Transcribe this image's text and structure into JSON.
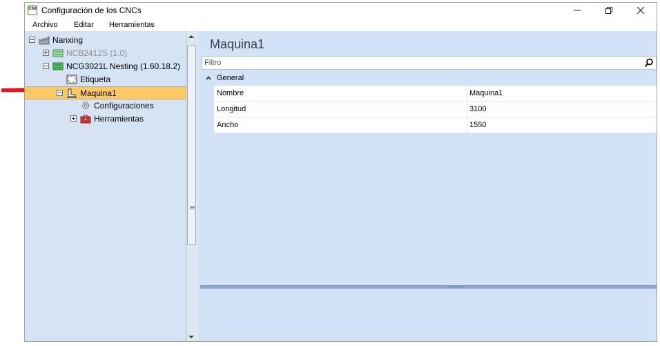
{
  "window": {
    "title": "Configuración de los CNCs",
    "icon_text": "CNC",
    "controls": {
      "minimize": "minimize-icon",
      "maximize": "restore-icon",
      "close": "close-icon"
    }
  },
  "menu": {
    "items": [
      "Archivo",
      "Editar",
      "Herramientas"
    ]
  },
  "tree": {
    "nodes": [
      {
        "label": "Nanxing",
        "icon": "factory-icon",
        "expanded": true,
        "muted": false
      },
      {
        "label": "NCB2412S (1.0)",
        "icon": "cnc-machine-icon",
        "expanded": false,
        "muted": true
      },
      {
        "label": "NCG3021L Nesting (1.60.18.2)",
        "icon": "cnc-machine-icon",
        "expanded": true,
        "muted": false
      },
      {
        "label": "Etiqueta",
        "icon": "label-icon",
        "muted": false
      },
      {
        "label": "Maquina1",
        "icon": "machine-icon",
        "expanded": true,
        "selected": true,
        "muted": false
      },
      {
        "label": "Configuraciones",
        "icon": "gear-icon",
        "muted": false
      },
      {
        "label": "Herramientas",
        "icon": "toolbox-icon",
        "expanded": false,
        "muted": false
      }
    ]
  },
  "details": {
    "title": "Maquina1",
    "filter_placeholder": "Filtro",
    "group": "General",
    "properties": [
      {
        "name": "Nombre",
        "value": "Maquina1"
      },
      {
        "name": "Longitud",
        "value": "3100"
      },
      {
        "name": "Ancho",
        "value": "1550"
      }
    ]
  },
  "colors": {
    "selection": "#fdc963",
    "pane_background": "#d3e3f7",
    "annotation_arrow": "#e8141c",
    "machine_icon_green": "#2e9b3e"
  }
}
